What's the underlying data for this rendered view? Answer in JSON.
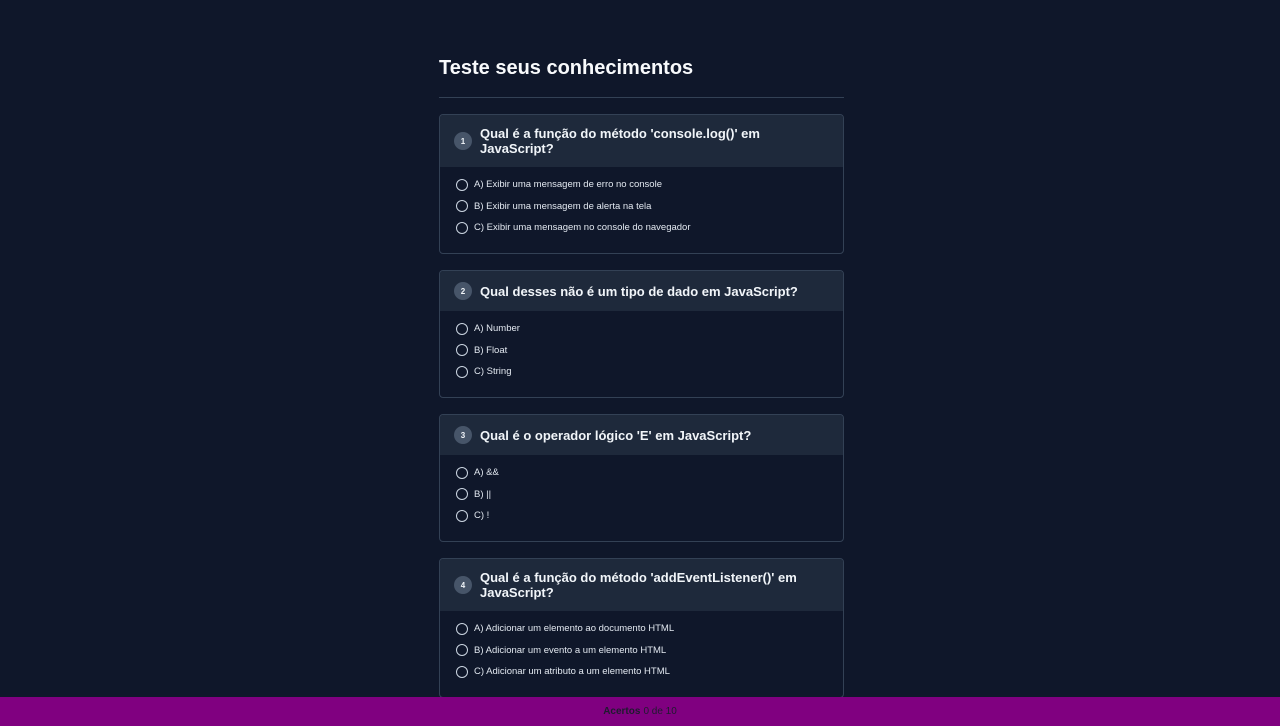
{
  "page": {
    "title": "Teste seus conhecimentos"
  },
  "questions": [
    {
      "number": "1",
      "text": "Qual é a função do método 'console.log()' em JavaScript?",
      "options": [
        "A) Exibir uma mensagem de erro no console",
        "B) Exibir uma mensagem de alerta na tela",
        "C) Exibir uma mensagem no console do navegador"
      ]
    },
    {
      "number": "2",
      "text": "Qual desses não é um tipo de dado em JavaScript?",
      "options": [
        "A) Number",
        "B) Float",
        "C) String"
      ]
    },
    {
      "number": "3",
      "text": "Qual é o operador lógico 'E' em JavaScript?",
      "options": [
        "A) &&",
        "B) ||",
        "C) !"
      ]
    },
    {
      "number": "4",
      "text": "Qual é a função do método 'addEventListener()' em JavaScript?",
      "options": [
        "A) Adicionar um elemento ao documento HTML",
        "B) Adicionar um evento a um elemento HTML",
        "C) Adicionar um atributo a um elemento HTML"
      ]
    }
  ],
  "footer": {
    "label": "Acertos",
    "score": "0 de 10"
  },
  "colors": {
    "background": "#0f172a",
    "card_header": "#1e293b",
    "border": "#334155",
    "footer": "#800080"
  }
}
